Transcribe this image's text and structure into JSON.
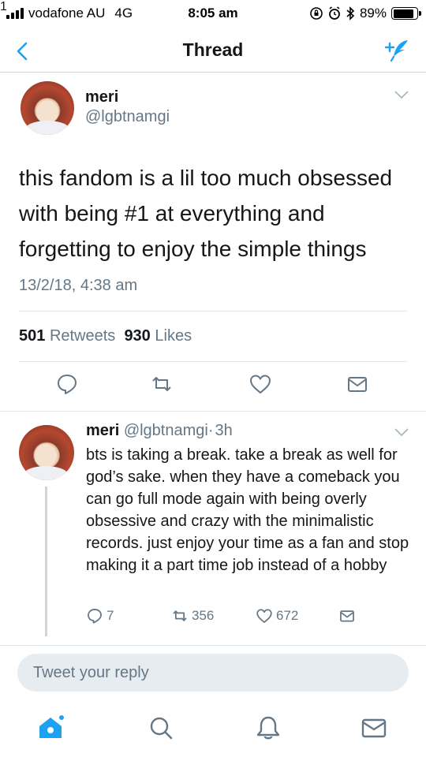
{
  "status_bar": {
    "carrier": "vodafone AU",
    "network": "4G",
    "time": "8:05 am",
    "battery_percent": "89%",
    "battery_level": 0.89
  },
  "nav": {
    "title": "Thread",
    "back_icon": "chevron-left-icon",
    "compose_icon": "compose-tweet-icon"
  },
  "main_tweet": {
    "name": "meri",
    "handle": "@lgbtnamgi",
    "text": "this fandom is a lil too much obsessed with being #1 at everything and forgetting to enjoy the simple things",
    "timestamp": "13/2/18, 4:38 am",
    "retweets_count": "501",
    "retweets_label": "Retweets",
    "likes_count": "930",
    "likes_label": "Likes"
  },
  "reply_tweet": {
    "name": "meri",
    "handle": "@lgbtnamgi",
    "separator": "·",
    "age": "3h",
    "text": "bts is taking a break. take a break as well for god’s sake. when they have a comeback you can go full mode again with being overly obsessive and crazy with the minimalistic records. just enjoy your time as a fan and stop making it a part time job instead of a hobby",
    "replies": "7",
    "retweets": "356",
    "likes": "672"
  },
  "reply_box": {
    "placeholder": "Tweet your reply"
  },
  "tab_bar": {
    "notifications_badge": "1"
  },
  "colors": {
    "accent": "#1da1f2",
    "secondary_text": "#657786",
    "divider": "#e1e8ed"
  }
}
